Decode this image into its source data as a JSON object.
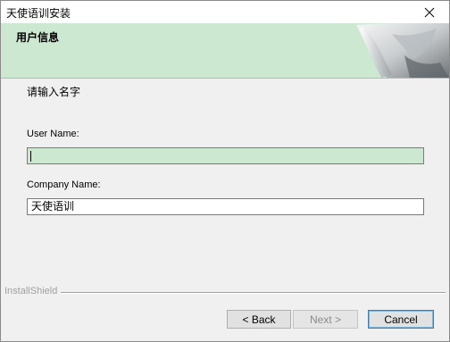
{
  "window": {
    "title": "天使语训安装"
  },
  "header": {
    "title": "用户信息"
  },
  "form": {
    "instruction": "请输入名字",
    "user_name": {
      "label": "User Name:",
      "value": ""
    },
    "company_name": {
      "label": "Company Name:",
      "value": "天使语训"
    }
  },
  "footer": {
    "brand": "InstallShield",
    "back_label": "< Back",
    "next_label": "Next >",
    "cancel_label": "Cancel"
  },
  "colors": {
    "header_bg": "#cde8d1",
    "window_bg": "#f0f0f0"
  }
}
